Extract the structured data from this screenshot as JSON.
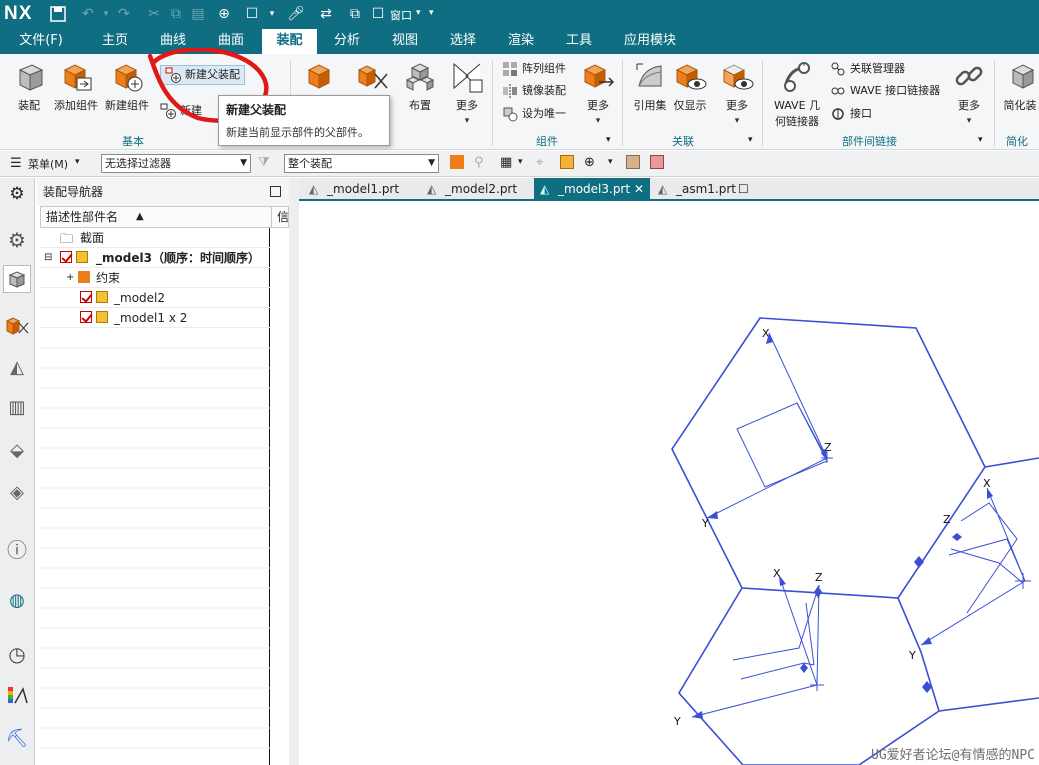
{
  "app": {
    "logo": "NX"
  },
  "quick_access": {
    "window_label": "窗口"
  },
  "menu": {
    "file": "文件(F)",
    "tabs": [
      "主页",
      "曲线",
      "曲面",
      "装配",
      "分析",
      "视图",
      "选择",
      "渲染",
      "工具",
      "应用模块"
    ]
  },
  "ribbon": {
    "basic": {
      "assemble": "装配",
      "add_component": "添加组件",
      "new_component": "新建组件",
      "new_parent": "新建父装配",
      "new_other": "新建",
      "group": "基本"
    },
    "layout": {
      "layout": "布置",
      "more": "更多"
    },
    "component": {
      "array": "阵列组件",
      "mirror": "镜像装配",
      "make_unique": "设为唯一",
      "more": "更多",
      "group": "组件"
    },
    "relation": {
      "ref_set": "引用集",
      "show_only": "仅显示",
      "more": "更多",
      "group": "关联"
    },
    "interpart": {
      "wave_line1": "WAVE 几",
      "wave_line2": "何链接器",
      "relation_mgr": "关联管理器",
      "wave_link": "WAVE 接口链接器",
      "interface": "接口",
      "more": "更多",
      "group": "部件间链接"
    },
    "simplify": {
      "label": "简化装",
      "group": "简化"
    }
  },
  "tooltip": {
    "title": "新建父装配",
    "desc": "新建当前显示部件的父部件。"
  },
  "toolbar2": {
    "menu": "菜单(M)",
    "filter": "无选择过滤器",
    "scope": "整个装配"
  },
  "navigator": {
    "title": "装配导航器",
    "col_name": "描述性部件名",
    "col_info": "信",
    "rows": [
      {
        "label": "截面"
      },
      {
        "label": "_model3（顺序：时间顺序）"
      },
      {
        "label": "约束"
      },
      {
        "label": "_model2"
      },
      {
        "label": "_model1 x 2"
      }
    ]
  },
  "doc_tabs": [
    "_model1.prt",
    "_model2.prt",
    "_model3.prt",
    "_asm1.prt"
  ],
  "watermark": "UG爱好者论坛@有情感的NPC",
  "colors": {
    "brand": "#0f6e82",
    "geometry": "#3b4fd6"
  }
}
